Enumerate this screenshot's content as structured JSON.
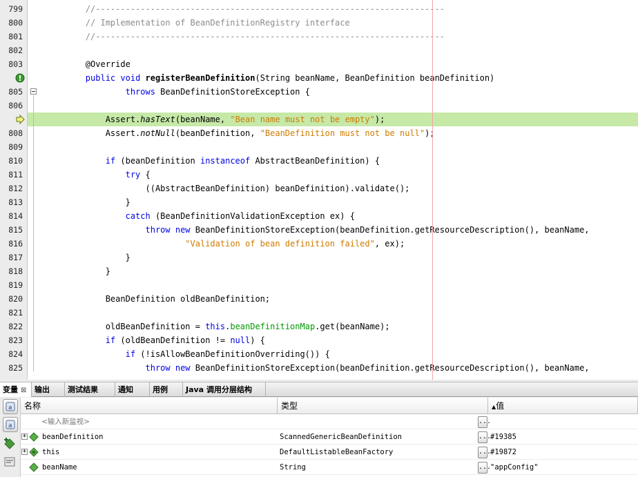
{
  "editor": {
    "lines": [
      {
        "n": "799",
        "tokens": [
          [
            "        ",
            "plain"
          ],
          [
            "//----------------------------------------------------------------------",
            "cm"
          ]
        ]
      },
      {
        "n": "800",
        "tokens": [
          [
            "        ",
            "plain"
          ],
          [
            "// Implementation of BeanDefinitionRegistry interface",
            "cm"
          ]
        ]
      },
      {
        "n": "801",
        "tokens": [
          [
            "        ",
            "plain"
          ],
          [
            "//----------------------------------------------------------------------",
            "cm"
          ]
        ]
      },
      {
        "n": "802",
        "tokens": []
      },
      {
        "n": "803",
        "tokens": [
          [
            "        ",
            "plain"
          ],
          [
            "@Override",
            "ann"
          ]
        ]
      },
      {
        "n": "",
        "tokens": [
          [
            "        ",
            "plain"
          ],
          [
            "public",
            "kw"
          ],
          [
            " ",
            "plain"
          ],
          [
            "void",
            "kw"
          ],
          [
            " ",
            "plain"
          ],
          [
            "registerBeanDefinition",
            "bold"
          ],
          [
            "(String beanName, BeanDefinition beanDefinition)",
            "plain"
          ]
        ]
      },
      {
        "n": "805",
        "tokens": [
          [
            "                ",
            "plain"
          ],
          [
            "throws",
            "kw"
          ],
          [
            " BeanDefinitionStoreException {",
            "plain"
          ]
        ]
      },
      {
        "n": "806",
        "tokens": []
      },
      {
        "n": "",
        "tokens": [
          [
            "            ",
            "plain"
          ],
          [
            "Assert.",
            "plain"
          ],
          [
            "hasText",
            "it"
          ],
          [
            "(beanName, ",
            "plain"
          ],
          [
            "\"Bean name must not be empty\"",
            "str"
          ],
          [
            ");",
            "plain"
          ]
        ]
      },
      {
        "n": "808",
        "tokens": [
          [
            "            ",
            "plain"
          ],
          [
            "Assert.",
            "plain"
          ],
          [
            "notNull",
            "it"
          ],
          [
            "(beanDefinition, ",
            "plain"
          ],
          [
            "\"BeanDefinition must not be null\"",
            "str"
          ],
          [
            ");",
            "plain"
          ]
        ]
      },
      {
        "n": "809",
        "tokens": []
      },
      {
        "n": "810",
        "tokens": [
          [
            "            ",
            "plain"
          ],
          [
            "if",
            "kw"
          ],
          [
            " (beanDefinition ",
            "plain"
          ],
          [
            "instanceof",
            "kw"
          ],
          [
            " AbstractBeanDefinition) {",
            "plain"
          ]
        ]
      },
      {
        "n": "811",
        "tokens": [
          [
            "                ",
            "plain"
          ],
          [
            "try",
            "kw"
          ],
          [
            " {",
            "plain"
          ]
        ]
      },
      {
        "n": "812",
        "tokens": [
          [
            "                    ",
            "plain"
          ],
          [
            "((AbstractBeanDefinition) beanDefinition).validate();",
            "plain"
          ]
        ]
      },
      {
        "n": "813",
        "tokens": [
          [
            "                ",
            "plain"
          ],
          [
            "}",
            "plain"
          ]
        ]
      },
      {
        "n": "814",
        "tokens": [
          [
            "                ",
            "plain"
          ],
          [
            "catch",
            "kw"
          ],
          [
            " (BeanDefinitionValidationException ex) {",
            "plain"
          ]
        ]
      },
      {
        "n": "815",
        "tokens": [
          [
            "                    ",
            "plain"
          ],
          [
            "throw",
            "kw"
          ],
          [
            " ",
            "plain"
          ],
          [
            "new",
            "kw"
          ],
          [
            " BeanDefinitionStoreException(beanDefinition.getResourceDescription(), beanName,",
            "plain"
          ]
        ]
      },
      {
        "n": "816",
        "tokens": [
          [
            "                            ",
            "plain"
          ],
          [
            "\"Validation of bean definition failed\"",
            "str"
          ],
          [
            ", ex);",
            "plain"
          ]
        ]
      },
      {
        "n": "817",
        "tokens": [
          [
            "                ",
            "plain"
          ],
          [
            "}",
            "plain"
          ]
        ]
      },
      {
        "n": "818",
        "tokens": [
          [
            "            ",
            "plain"
          ],
          [
            "}",
            "plain"
          ]
        ]
      },
      {
        "n": "819",
        "tokens": []
      },
      {
        "n": "820",
        "tokens": [
          [
            "            ",
            "plain"
          ],
          [
            "BeanDefinition oldBeanDefinition;",
            "plain"
          ]
        ]
      },
      {
        "n": "821",
        "tokens": []
      },
      {
        "n": "822",
        "tokens": [
          [
            "            ",
            "plain"
          ],
          [
            "oldBeanDefinition = ",
            "plain"
          ],
          [
            "this",
            "kw"
          ],
          [
            ".",
            "plain"
          ],
          [
            "beanDefinitionMap",
            "field"
          ],
          [
            ".get(beanName);",
            "plain"
          ]
        ]
      },
      {
        "n": "823",
        "tokens": [
          [
            "            ",
            "plain"
          ],
          [
            "if",
            "kw"
          ],
          [
            " (oldBeanDefinition != ",
            "plain"
          ],
          [
            "null",
            "kw"
          ],
          [
            ") {",
            "plain"
          ]
        ]
      },
      {
        "n": "824",
        "tokens": [
          [
            "                ",
            "plain"
          ],
          [
            "if",
            "kw"
          ],
          [
            " (!isAllowBeanDefinitionOverriding()) {",
            "plain"
          ]
        ]
      },
      {
        "n": "825",
        "tokens": [
          [
            "                    ",
            "plain"
          ],
          [
            "throw",
            "kw"
          ],
          [
            " ",
            "plain"
          ],
          [
            "new",
            "kw"
          ],
          [
            " BeanDefinitionStoreException(beanDefinition.getResourceDescription(), beanName,",
            "plain"
          ]
        ]
      }
    ]
  },
  "tabs": [
    {
      "label": "变量",
      "close": "⊠"
    },
    {
      "label": "输出"
    },
    {
      "label": "测试结果"
    },
    {
      "label": "通知"
    },
    {
      "label": "用例"
    },
    {
      "label": "Java 调用分层结构"
    }
  ],
  "variables": {
    "columns": {
      "name": "名称",
      "type": "类型",
      "value": "值",
      "sort_indicator": "▲"
    },
    "new_watch_placeholder": "<输入新监视>",
    "ellipsis": "...",
    "rows": [
      {
        "name": "beanDefinition",
        "type": "ScannedGenericBeanDefinition",
        "value": "#19385",
        "expandable": true,
        "icon": "field-icon"
      },
      {
        "name": "this",
        "type": "DefaultListableBeanFactory",
        "value": "#19872",
        "expandable": true,
        "icon": "this-icon"
      },
      {
        "name": "beanName",
        "type": "String",
        "value": "\"appConfig\"",
        "expandable": false,
        "icon": "field-icon"
      }
    ]
  },
  "colors": {
    "highlight": "#c6e9a8",
    "keyword": "#0000e6",
    "string": "#ce7b00",
    "comment": "#8c8c8c"
  }
}
